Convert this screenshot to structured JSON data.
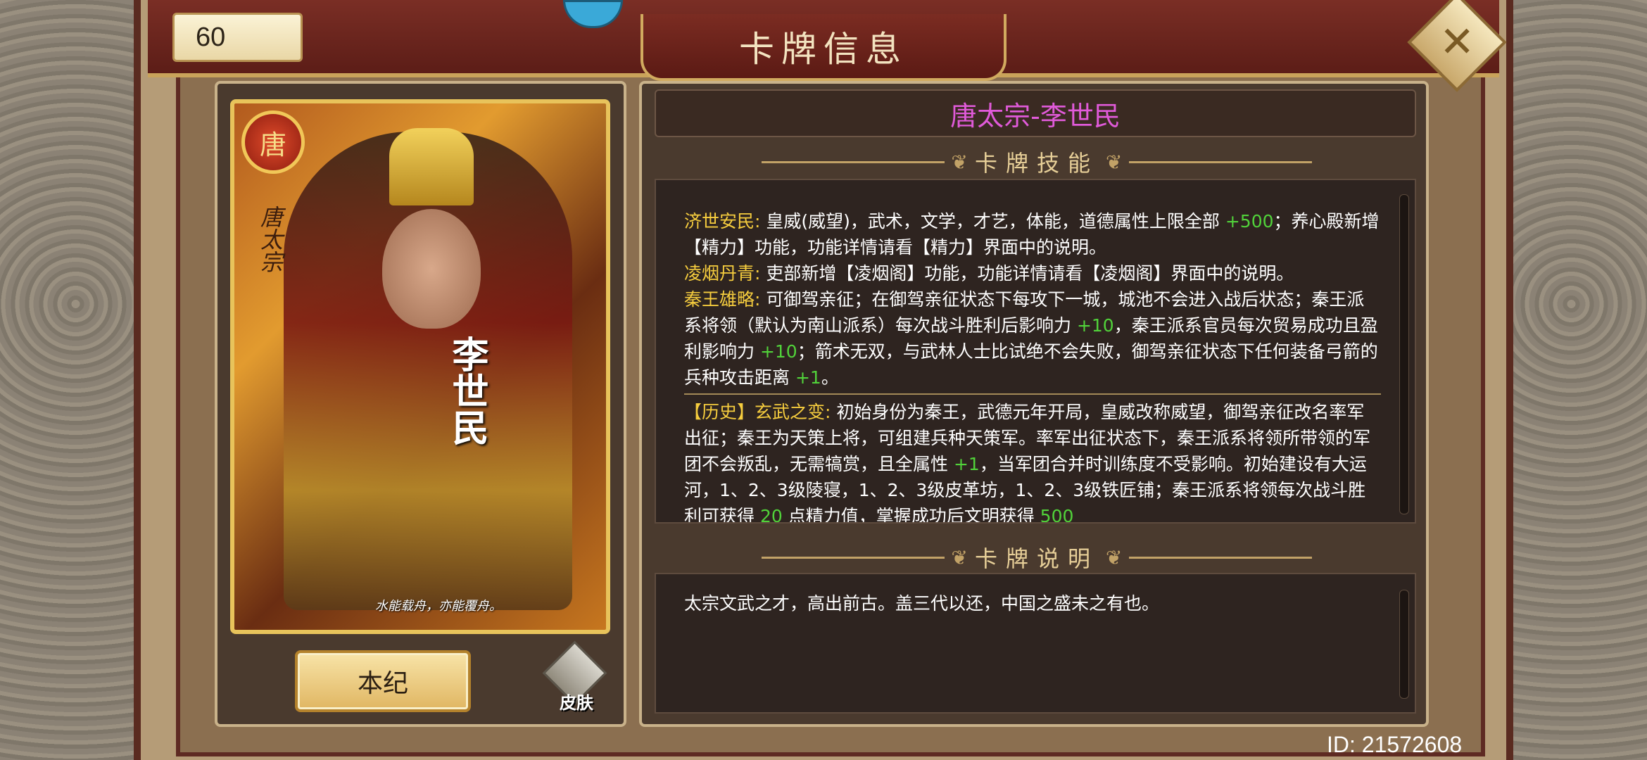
{
  "header": {
    "level": "60",
    "title": "卡牌信息",
    "close_icon": "close-x-icon"
  },
  "card": {
    "emblem": "唐",
    "dynasty_label": "唐太宗",
    "name_vertical": "李世民",
    "quote": "水能载舟，亦能覆舟。"
  },
  "buttons": {
    "benji": "本纪",
    "skin": "皮肤"
  },
  "info": {
    "name": "唐太宗-李世民",
    "skills_heading": "卡牌技能",
    "desc_heading": "卡牌说明",
    "skills": [
      {
        "name": "济世安民:",
        "segments": [
          {
            "t": " 皇威(威望)，武术，文学，才艺，体能，道德属性上限全部 "
          },
          {
            "t": "+500",
            "green": true
          },
          {
            "t": "；养心殿新增【精力】功能，功能详情请看【精力】界面中的说明。"
          }
        ]
      },
      {
        "name": "凌烟丹青:",
        "segments": [
          {
            "t": " 吏部新增【凌烟阁】功能，功能详情请看【凌烟阁】界面中的说明。"
          }
        ]
      },
      {
        "name": "秦王雄略:",
        "segments": [
          {
            "t": " 可御驾亲征；在御驾亲征状态下每攻下一城，城池不会进入战后状态；秦王派系将领（默认为南山派系）每次战斗胜利后影响力 "
          },
          {
            "t": "+10",
            "green": true
          },
          {
            "t": "，秦王派系官员每次贸易成功且盈利影响力 "
          },
          {
            "t": "+10",
            "green": true
          },
          {
            "t": "；箭术无双，与武林人士比试绝不会失败，御驾亲征状态下任何装备弓箭的兵种攻击距离 "
          },
          {
            "t": "+1",
            "green": true
          },
          {
            "t": "。"
          }
        ]
      }
    ],
    "history": {
      "name": "【历史】玄武之变:",
      "segments": [
        {
          "t": " 初始身份为秦王，武德元年开局，皇威改称威望，御驾亲征改名率军出征；秦王为天策上将，可组建兵种天策军。率军出征状态下，秦王派系将领所带领的军团不会叛乱，无需犒赏，且全属性 "
        },
        {
          "t": "+1",
          "green": true
        },
        {
          "t": "，当军团合并时训练度不受影响。初始建设有大运河，1、2、3级陵寝，1、2、3级皮革坊，1、2、3级铁匠铺；秦王派系将领每次战斗胜利可获得 "
        },
        {
          "t": "20",
          "green": true
        },
        {
          "t": " 点精力值，掌握成功后文明获得 "
        },
        {
          "t": "500",
          "green": true
        }
      ]
    },
    "description": "太宗文武之才，高出前古。盖三代以还，中国之盛未之有也。"
  },
  "footer": {
    "id_label": "ID: 21572608"
  }
}
